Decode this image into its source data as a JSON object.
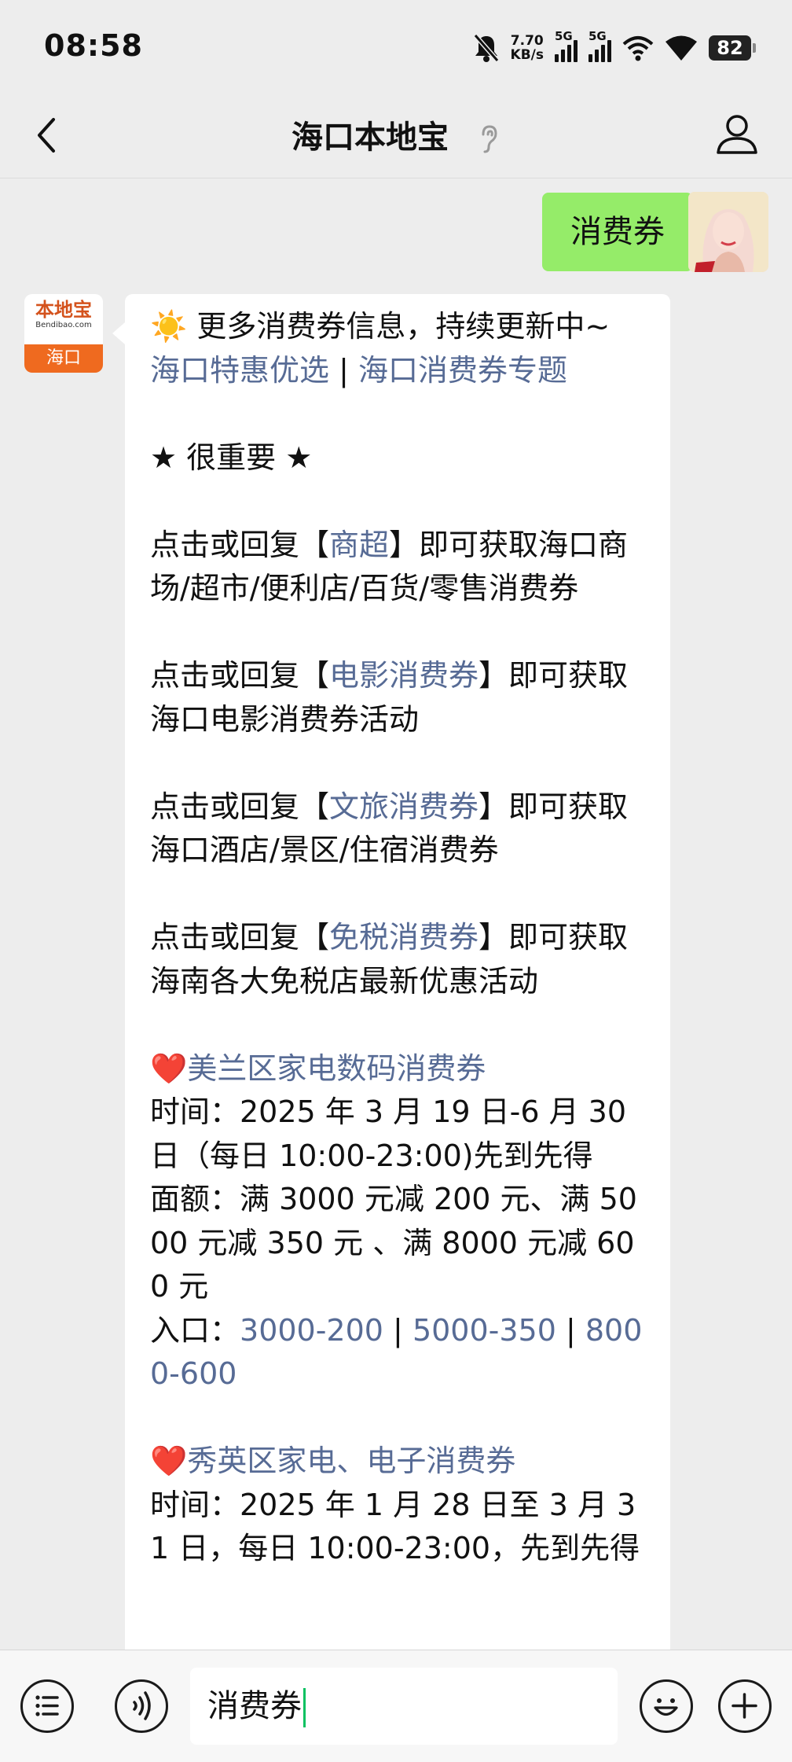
{
  "status_bar": {
    "time": "08:58",
    "speed_value": "7.70",
    "speed_unit": "KB/s",
    "signal_1": "5G",
    "signal_2": "5G",
    "battery": "82"
  },
  "header": {
    "title": "海口本地宝"
  },
  "sent_message": "消费券",
  "bot": {
    "logo_text": "本地宝",
    "logo_sub": "Bendibao.com",
    "city": "海口"
  },
  "message": {
    "l1_icon": "☀️",
    "l1_text": " 更多消费券信息，持续更新中~",
    "link_tehui": "海口特惠优选",
    "sep1": " | ",
    "link_zhuanti": "海口消费券专题",
    "important": "★ 很重要 ★",
    "p1_pre": "点击或回复【",
    "p1_link": "商超",
    "p1_post": "】即可获取海口商场/超市/便利店/百货/零售消费券",
    "p2_pre": "点击或回复【",
    "p2_link": "电影消费券",
    "p2_post": "】即可获取海口电影消费券活动",
    "p3_pre": "点击或回复【",
    "p3_link": "文旅消费券",
    "p3_post": "】即可获取海口酒店/景区/住宿消费券",
    "p4_pre": "点击或回复【",
    "p4_link": "免税消费券",
    "p4_post": "】即可获取海南各大免税店最新优惠活动",
    "s1_heart": "❤️",
    "s1_title": "美兰区家电数码消费券",
    "s1_time": "时间：2025 年 3 月 19 日-6 月 30 日（每日 10:00-23:00)先到先得",
    "s1_amount": "面额：满 3000 元减 200 元、满 5000 元减 350 元 、满 8000 元减 600 元",
    "s1_entry_label": "入口：",
    "s1_e1": "3000-200",
    "s1_sep1": " | ",
    "s1_e2": "5000-350",
    "s1_sep2": " | ",
    "s1_e3": "8000-600",
    "s2_heart": "❤️",
    "s2_title": "秀英区家电、电子消费券",
    "s2_time": "时间：2025 年 1 月 28 日至 3 月 31 日，每日 10:00-23:00，先到先得"
  },
  "input": {
    "value": "消费券"
  },
  "icons": {
    "back": "chevron-left-icon",
    "ear": "ear-icon",
    "profile": "person-icon",
    "menu": "list-icon",
    "voice": "voice-icon",
    "emoji": "emoji-icon",
    "plus": "plus-icon"
  },
  "colors": {
    "sent_bubble": "#95ec69",
    "link": "#576b95",
    "background": "#ededed",
    "brand_orange": "#ef6a1f"
  }
}
